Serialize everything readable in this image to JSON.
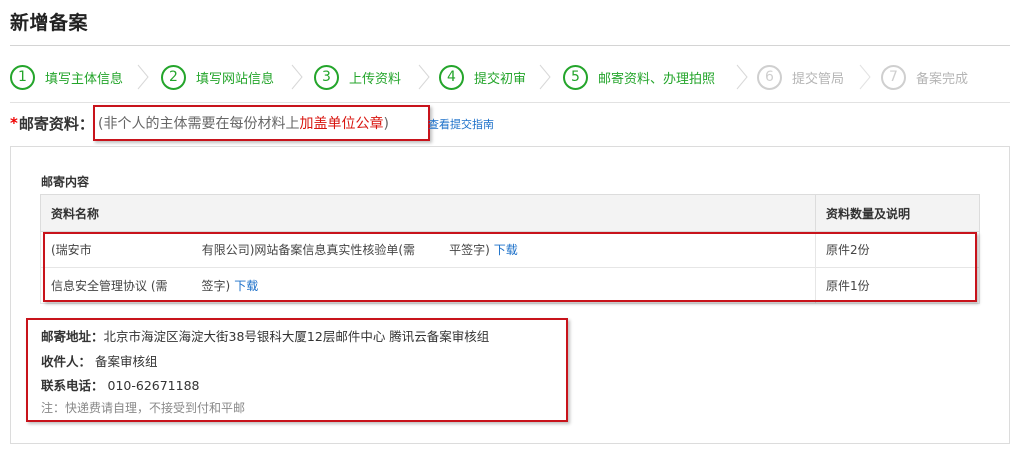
{
  "page": {
    "title": "新增备案"
  },
  "steps": [
    {
      "num": "1",
      "label": "填写主体信息",
      "active": true
    },
    {
      "num": "2",
      "label": "填写网站信息",
      "active": true
    },
    {
      "num": "3",
      "label": "上传资料",
      "active": true
    },
    {
      "num": "4",
      "label": "提交初审",
      "active": true
    },
    {
      "num": "5",
      "label": "邮寄资料、办理拍照",
      "active": true
    },
    {
      "num": "6",
      "label": "提交管局",
      "active": false
    },
    {
      "num": "7",
      "label": "备案完成",
      "active": false
    }
  ],
  "mail_section": {
    "star": "*",
    "label": "邮寄资料：",
    "notice_prefix": "(非个人的主体需要在每份材料上",
    "notice_highlight": "加盖单位公章",
    "notice_suffix": ")",
    "guide_link": "查看提交指南"
  },
  "content": {
    "title": "邮寄内容",
    "table": {
      "headers": [
        "资料名称",
        "资料数量及说明"
      ],
      "rows": [
        {
          "name_a": "(瑞安市",
          "name_b": "有限公司)网站备案信息真实性核验单(需",
          "name_c": "平签字)",
          "link": "下载",
          "qty": "原件2份"
        },
        {
          "name_a": "信息安全管理协议 (需",
          "name_b": "",
          "name_c": "签字)",
          "link": "下载",
          "qty": "原件1份"
        }
      ]
    }
  },
  "address": {
    "addr_label": "邮寄地址：",
    "addr_value": "北京市海淀区海淀大街38号银科大厦12层邮件中心 腾讯云备案审核组",
    "recipient_label": "收件人：",
    "recipient_value": "备案审核组",
    "phone_label": "联系电话：",
    "phone_value": "010-62671188",
    "note": "注：快递费请自理，不接受到付和平邮"
  },
  "colors": {
    "accent": "#24a52b",
    "inactive": "#cfcfcf",
    "highlight_red": "#c8131b",
    "link": "#1a6fc9"
  }
}
